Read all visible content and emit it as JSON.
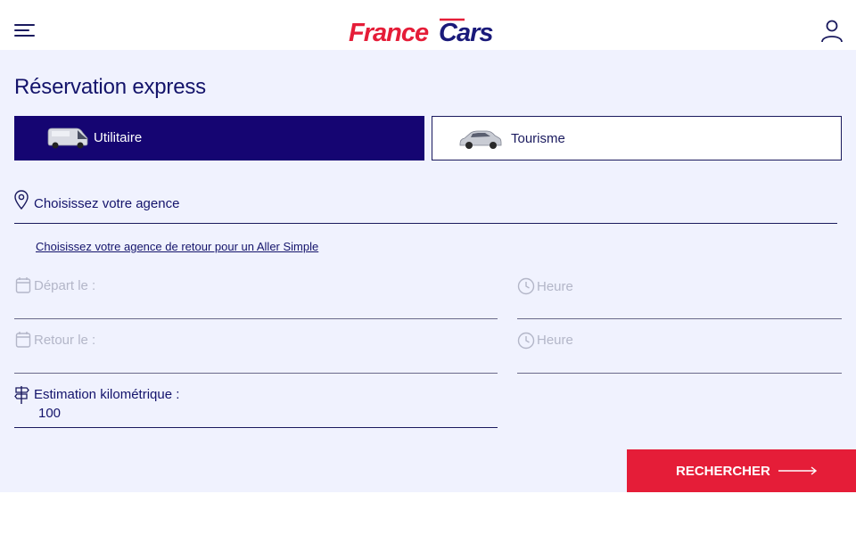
{
  "header": {
    "menu_icon": "hamburger-icon",
    "logo_text": "FRANCECARS",
    "account_icon": "user-icon",
    "colors": {
      "brand_red": "#e51d38",
      "brand_navy": "#1a1a5e"
    }
  },
  "booking": {
    "title": "Réservation express",
    "vehicle_tabs": [
      {
        "label": "Utilitaire",
        "icon": "van-icon",
        "selected": true
      },
      {
        "label": "Tourisme",
        "icon": "car-icon",
        "selected": false
      }
    ],
    "agency": {
      "label": "Choisissez votre agence",
      "icon": "location-pin-icon"
    },
    "return_agency_link": "Choisissez votre agence de retour pour un Aller Simple",
    "departure": {
      "label": "Départ le :",
      "icon": "calendar-icon"
    },
    "departure_time": {
      "label": "Heure",
      "icon": "clock-icon"
    },
    "return": {
      "label": "Retour le :",
      "icon": "calendar-icon"
    },
    "return_time": {
      "label": "Heure",
      "icon": "clock-icon"
    },
    "mileage": {
      "label": "Estimation kilométrique :",
      "value": "100",
      "icon": "signpost-icon"
    },
    "search_button": {
      "label": "RECHERCHER",
      "icon": "arrow-right-icon"
    },
    "colors": {
      "selected_tab_bg": "#150572",
      "panel_bg": "#f0f2fe",
      "disabled_text": "#b3b6c8"
    }
  }
}
